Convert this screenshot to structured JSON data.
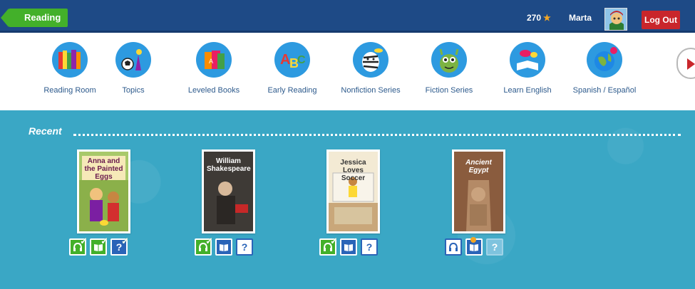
{
  "header": {
    "section": "Reading",
    "stars": "270",
    "star_glyph": "★",
    "username": "Marta",
    "logout_label": "Log Out"
  },
  "nav": {
    "items": [
      {
        "label": "Reading Room",
        "icon": "books-icon"
      },
      {
        "label": "Topics",
        "icon": "topics-icon"
      },
      {
        "label": "Leveled Books",
        "icon": "leveled-books-icon"
      },
      {
        "label": "Early Reading",
        "icon": "abc-icon"
      },
      {
        "label": "Nonfiction Series",
        "icon": "zebra-icon"
      },
      {
        "label": "Fiction Series",
        "icon": "monster-icon"
      },
      {
        "label": "Learn English",
        "icon": "speech-book-icon"
      },
      {
        "label": "Spanish / Español",
        "icon": "globe-icon"
      }
    ],
    "next_icon": "chevron-right-icon"
  },
  "recent": {
    "title": "Recent",
    "books": [
      {
        "title": "Anna and the Painted Eggs",
        "cover_color": "#a8c96a"
      },
      {
        "title": "William Shakespeare",
        "cover_color": "#4a4642"
      },
      {
        "title": "Jessica Loves Soccer",
        "cover_color": "#e8d9b8"
      },
      {
        "title": "Ancient Egypt",
        "cover_color": "#9a6a4a"
      }
    ],
    "quiz_glyph": "?"
  },
  "colors": {
    "topbar": "#1e4a86",
    "reading_tab": "#43b02a",
    "logout": "#c9262b",
    "main_bg": "#3aa7c5"
  }
}
